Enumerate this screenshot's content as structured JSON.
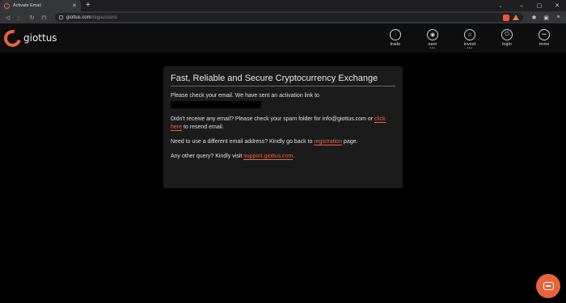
{
  "browser": {
    "tab_title": "Activate Email",
    "tab_close": "✕",
    "new_tab": "+",
    "tab_search_icon": "⌄",
    "url_host": "giottus.com",
    "url_path": "/regsuccess",
    "window_controls": [
      "–",
      "▢",
      "✕"
    ]
  },
  "site": {
    "logo_text": "giottus",
    "nav": [
      {
        "label": "trade",
        "icon": "trade-icon",
        "glyph": "⫶",
        "dots": ""
      },
      {
        "label": "earn",
        "icon": "earn-icon",
        "glyph": "◉",
        "dots": "•••"
      },
      {
        "label": "invest",
        "icon": "invest-icon",
        "glyph": "☺",
        "dots": "•••"
      },
      {
        "label": "login",
        "icon": "login-icon",
        "glyph": "⏻",
        "dots": ""
      },
      {
        "label": "more",
        "icon": "more-icon",
        "glyph": "•••",
        "dots": ""
      }
    ]
  },
  "card": {
    "title": "Fast, Reliable and Secure Cryptocurrency Exchange",
    "p1": "Please check your email. We have sent an activation link to",
    "p2_a": "Didn't receive any email? Please check your spam folder for info@giottus.com or",
    "p2_link": "click here",
    "p2_b": "to resend email.",
    "p3_a": "Need to use a different email address? Kindly go back to",
    "p3_link": "registration",
    "p3_b": "page.",
    "p4_a": "Any other query? Kindly visit",
    "p4_link": "support.giottus.com",
    "p4_b": "."
  },
  "colors": {
    "accent": "#e8643a",
    "background": "#000000",
    "card": "#1b1b1b"
  }
}
